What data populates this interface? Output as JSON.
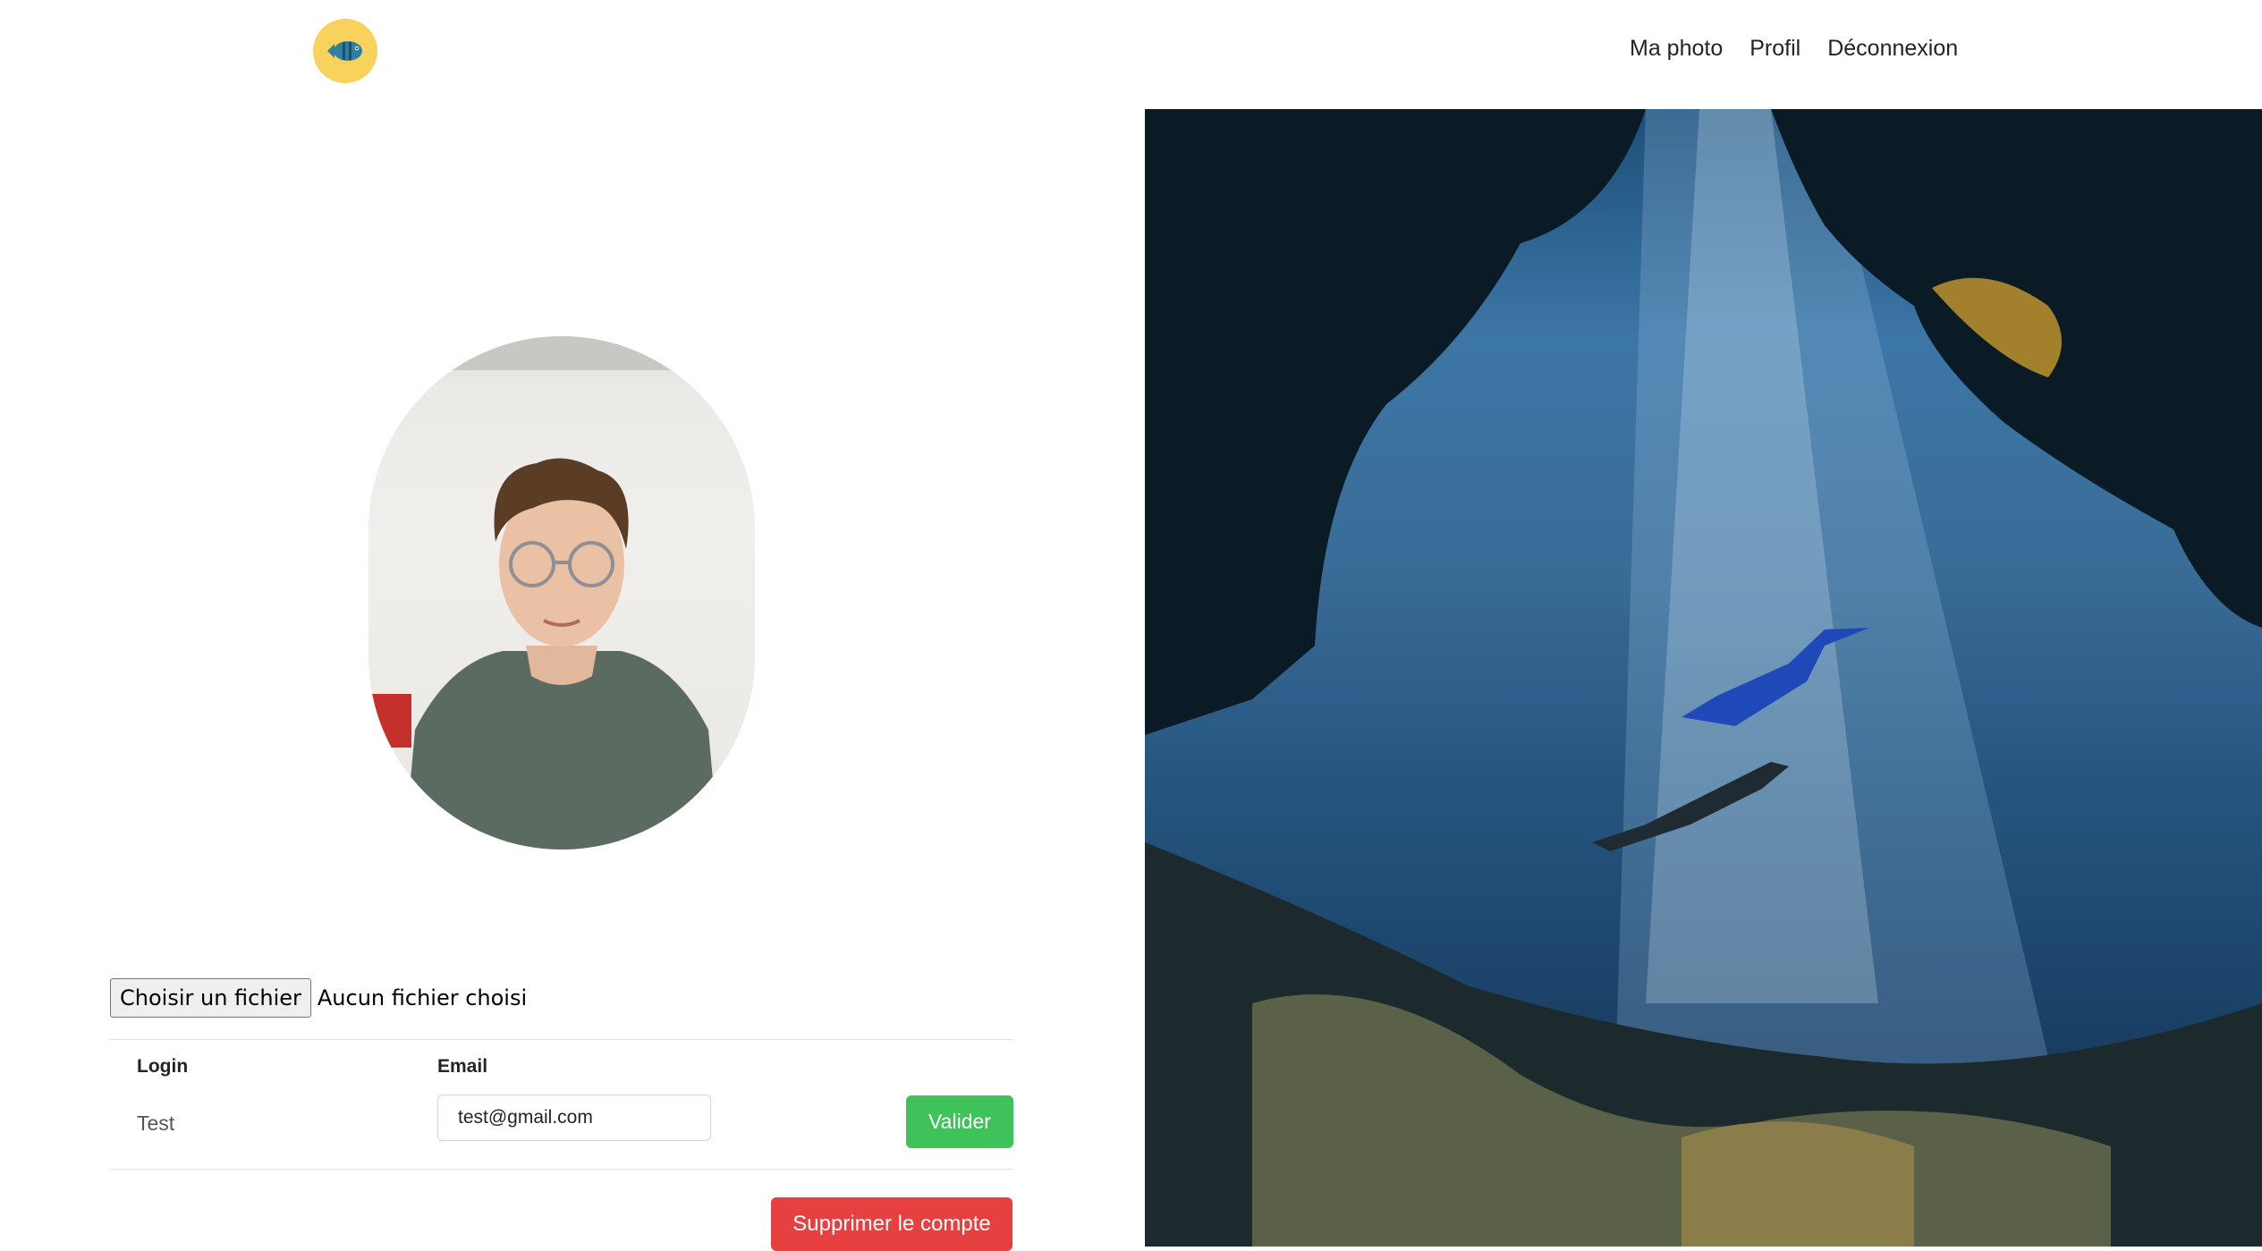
{
  "nav": {
    "logo_icon": "fish-icon",
    "links": [
      "Ma photo",
      "Profil",
      "Déconnexion"
    ]
  },
  "profile": {
    "file_button": "Choisir un fichier",
    "file_status": "Aucun fichier choisi",
    "login_header": "Login",
    "email_header": "Email",
    "login_value": "Test",
    "email_value": "test@gmail.com",
    "submit_label": "Valider",
    "delete_label": "Supprimer le compte"
  },
  "colors": {
    "logo_bg": "#f9d25c",
    "success": "#3fc25a",
    "danger": "#e64040"
  }
}
